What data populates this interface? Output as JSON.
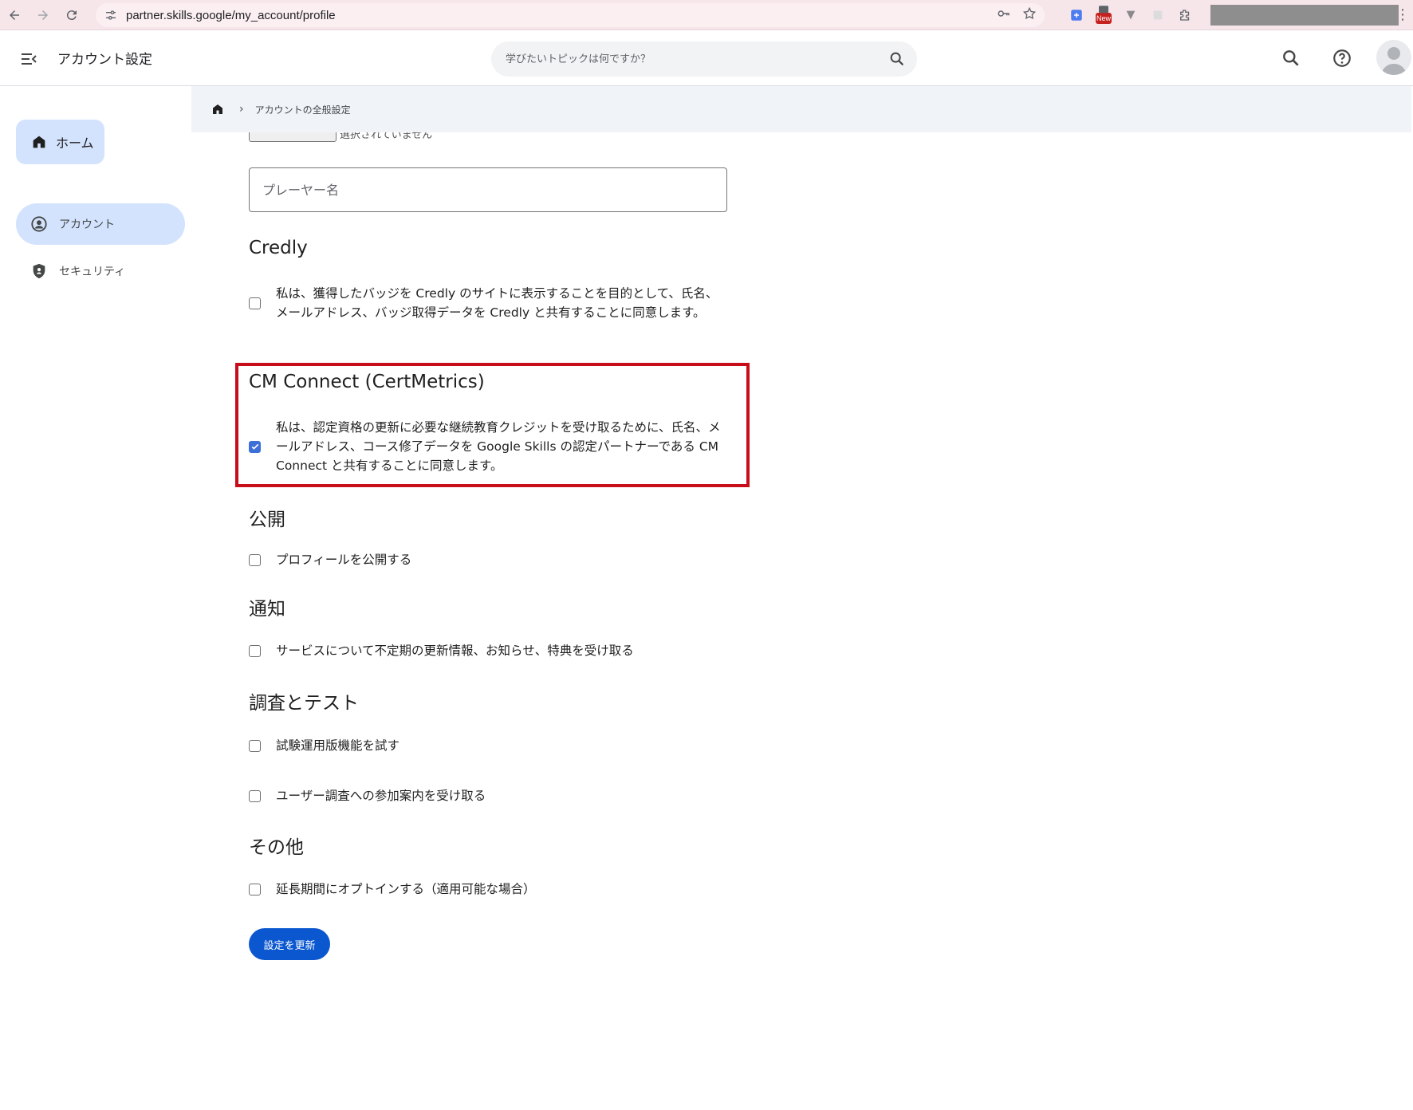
{
  "browser": {
    "url": "partner.skills.google/my_account/profile",
    "new_badge": "New"
  },
  "header": {
    "title": "アカウント設定",
    "search_placeholder": "学びたいトピックは何ですか？"
  },
  "sidebar": {
    "home_label": "ホーム",
    "items": [
      {
        "label": "アカウント",
        "icon": "account-circle-icon",
        "active": true
      },
      {
        "label": "セキュリティ",
        "icon": "shield-icon",
        "active": false
      }
    ]
  },
  "breadcrumb": {
    "current": "アカウントの全般設定"
  },
  "form": {
    "file_status": "選択されていません",
    "player_name_placeholder": "プレーヤー名",
    "sections": {
      "credly": {
        "title": "Credly",
        "consent": "私は、獲得したバッジを Credly のサイトに表示することを目的として、氏名、メールアドレス、バッジ取得データを Credly と共有することに同意します。",
        "checked": false
      },
      "cm_connect": {
        "title": "CM Connect (CertMetrics)",
        "consent": "私は、認定資格の更新に必要な継続教育クレジットを受け取るために、氏名、メールアドレス、コース修了データを Google Skills の認定パートナーである CM Connect と共有することに同意します。",
        "checked": true
      },
      "public": {
        "title": "公開",
        "option": "プロフィールを公開する",
        "checked": false
      },
      "notifications": {
        "title": "通知",
        "option": "サービスについて不定期の更新情報、お知らせ、特典を受け取る",
        "checked": false
      },
      "research": {
        "title": "調査とテスト",
        "option1": "試験運用版機能を試す",
        "option2": "ユーザー調査への参加案内を受け取る"
      },
      "other": {
        "title": "その他",
        "option": "延長期間にオプトインする（適用可能な場合）"
      }
    },
    "submit_label": "設定を更新"
  },
  "colors": {
    "accent": "#0b57d0",
    "highlight": "#c70d1a",
    "nav_active": "#d3e3fd"
  }
}
